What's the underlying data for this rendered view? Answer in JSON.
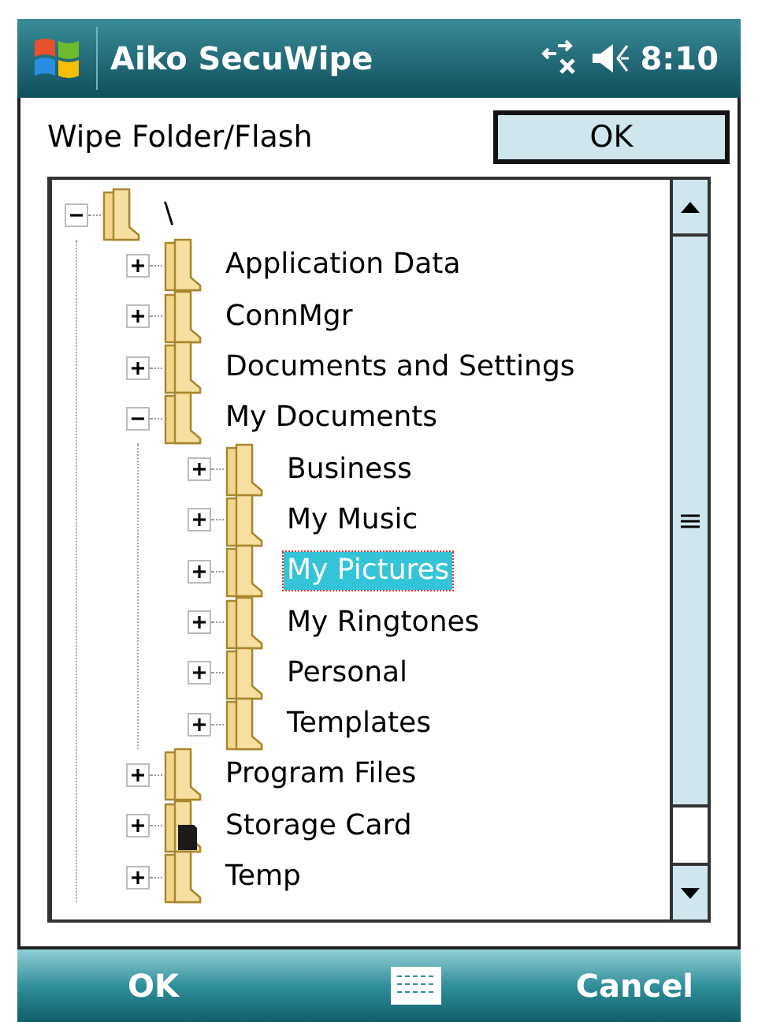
{
  "title_bar": {
    "title": "Aiko SecuWipe",
    "time": "8:10"
  },
  "header": {
    "label": "Wipe Folder/Flash",
    "button": "OK"
  },
  "tree": [
    {
      "label": "\\",
      "kind": "folder",
      "expanded": true,
      "selected": false,
      "children": [
        {
          "label": "Application Data",
          "kind": "folder",
          "expanded": false,
          "selected": false
        },
        {
          "label": "ConnMgr",
          "kind": "folder",
          "expanded": false,
          "selected": false
        },
        {
          "label": "Documents and Settings",
          "kind": "folder",
          "expanded": false,
          "selected": false
        },
        {
          "label": "My Documents",
          "kind": "folder",
          "expanded": true,
          "selected": false,
          "children": [
            {
              "label": "Business",
              "kind": "folder",
              "expanded": false,
              "selected": false
            },
            {
              "label": "My Music",
              "kind": "folder",
              "expanded": false,
              "selected": false
            },
            {
              "label": "My Pictures",
              "kind": "folder",
              "expanded": false,
              "selected": true
            },
            {
              "label": "My Ringtones",
              "kind": "folder",
              "expanded": false,
              "selected": false
            },
            {
              "label": "Personal",
              "kind": "folder",
              "expanded": false,
              "selected": false
            },
            {
              "label": "Templates",
              "kind": "folder",
              "expanded": false,
              "selected": false
            }
          ]
        },
        {
          "label": "Program Files",
          "kind": "folder",
          "expanded": false,
          "selected": false
        },
        {
          "label": "Storage Card",
          "kind": "storage-card",
          "expanded": false,
          "selected": false
        },
        {
          "label": "Temp",
          "kind": "folder",
          "expanded": false,
          "selected": false
        }
      ]
    }
  ],
  "softkeys": {
    "left": "OK",
    "right": "Cancel"
  }
}
